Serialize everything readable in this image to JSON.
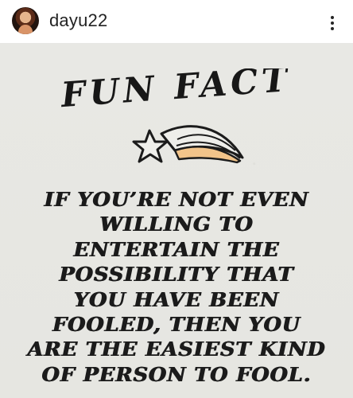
{
  "post": {
    "username": "dayu22",
    "more_options_icon": "vertical-ellipsis-icon"
  },
  "image": {
    "title": "FUN FACT",
    "quote_lines": [
      "IF YOU’RE NOT EVEN",
      "WILLING TO",
      "ENTERTAIN THE",
      "POSSIBILITY THAT",
      "YOU HAVE BEEN",
      "FOOLED, THEN YOU",
      "ARE THE EASIEST KIND",
      "OF PERSON TO FOOL."
    ],
    "decoration_icon": "shooting-star-icon"
  },
  "colors": {
    "header_background": "#ffffff",
    "post_background": "#e7e7e3",
    "text": "#1b1b1b",
    "star_fill": "#f2c48a"
  }
}
